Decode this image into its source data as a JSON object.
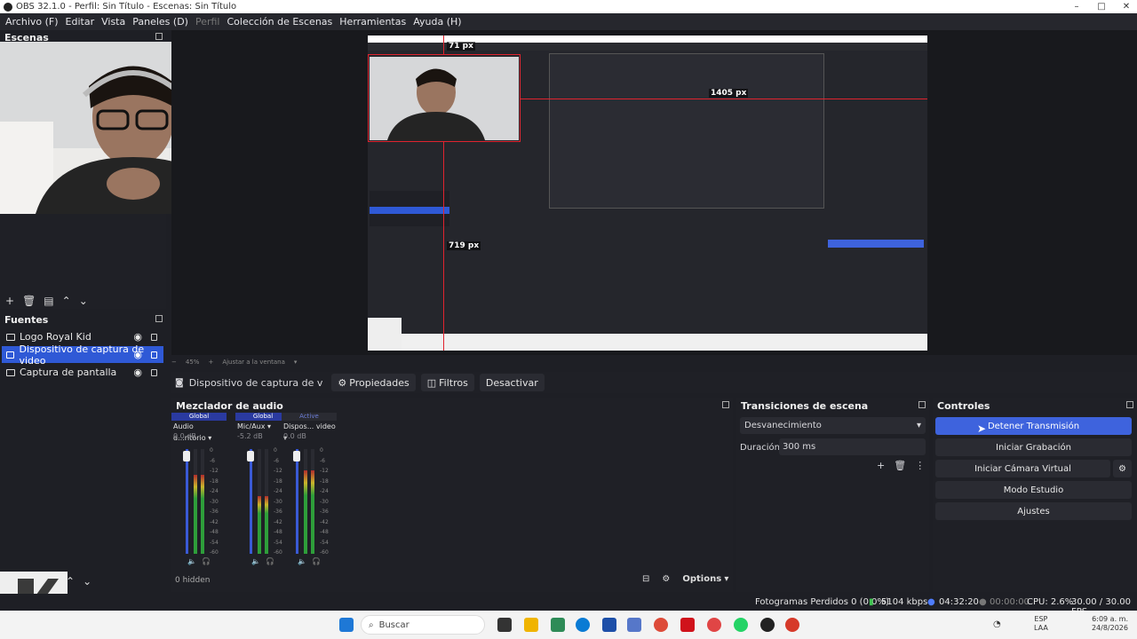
{
  "window": {
    "title": "OBS 32.1.0 - Perfil: Sin Título - Escenas: Sin Título",
    "min": "–",
    "max": "□",
    "close": "✕"
  },
  "menu": [
    "Archivo (F)",
    "Editar",
    "Vista",
    "Paneles (D)",
    "Perfil",
    "Colección de Escenas",
    "Herramientas",
    "Ayuda (H)"
  ],
  "scenes": {
    "header": "Escenas"
  },
  "sources": {
    "header": "Fuentes",
    "items": [
      {
        "label": "Logo Royal Kid",
        "selected": false
      },
      {
        "label": "Dispositivo de captura de video",
        "selected": true
      },
      {
        "label": "Captura de pantalla",
        "selected": false
      }
    ]
  },
  "preview": {
    "width_label": "71 px",
    "width_label2": "1405 px",
    "height_label": "719 px"
  },
  "zoom": {
    "value": "45%",
    "fit": "Ajustar a la ventana"
  },
  "source_toolbar": {
    "source_name": "Dispositivo de captura de v",
    "properties": "Propiedades",
    "filters": "Filtros",
    "deactivate": "Desactivar"
  },
  "mixer": {
    "header": "Mezclador de audio",
    "channels": [
      {
        "tag": "Global",
        "name": "Audio d...ritorio",
        "db": "0.0 dB",
        "level": 0.75
      },
      {
        "tag": "Global",
        "name": "Mic/Aux",
        "db": "-5.2 dB",
        "level": 0.55
      },
      {
        "tag": "Active",
        "name": "Dispos... video",
        "db": "0.0 dB",
        "level": 0.8
      }
    ],
    "scale": [
      "0",
      "-6",
      "-12",
      "-18",
      "-24",
      "-30",
      "-36",
      "-42",
      "-48",
      "-54",
      "-60"
    ],
    "hidden": "0 hidden",
    "options": "Options"
  },
  "transitions": {
    "header": "Transiciones de escena",
    "selected": "Desvanecimiento",
    "duration_label": "Duración",
    "duration_value": "300 ms"
  },
  "controls": {
    "header": "Controles",
    "stop_stream": "Detener Transmisión",
    "start_record": "Iniciar Grabación",
    "virtual_cam": "Iniciar Cámara Virtual",
    "studio_mode": "Modo Estudio",
    "settings": "Ajustes"
  },
  "status": {
    "dropped": "Fotogramas Perdidos 0 (0.0%)",
    "kbps": "5104 kbps",
    "stream_time": "04:32:20",
    "rec_time": "00:00:00",
    "cpu": "CPU: 2.6%",
    "fps": "30.00 / 30.00 FPS"
  },
  "taskbar": {
    "search": "Buscar",
    "lang": "ESP",
    "lang2": "LAA",
    "time": "6:09 a. m.",
    "date": "24/8/2026"
  },
  "colors": {
    "accent": "#3e63dd",
    "red": "#e0232e"
  }
}
